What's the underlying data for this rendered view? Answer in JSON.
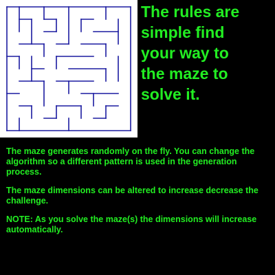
{
  "colors": {
    "background": "#000000",
    "maze_background": "#ffffff",
    "maze_walls": "#1a1aa0",
    "text": "#22ee22"
  },
  "headline": {
    "lines": [
      "The rules are",
      "simple find",
      "your way to",
      "the maze to",
      "solve it."
    ]
  },
  "info": {
    "paragraph1": "The maze generates randomly on the fly. You can change the algorithm so a different pattern is used in the generation process.",
    "paragraph2": "The maze dimensions can be altered to increase decrease the challenge.",
    "paragraph3": "NOTE: As you solve the maze(s) the dimensions will increase automatically."
  },
  "maze": {
    "rows": 10,
    "cols": 10
  }
}
